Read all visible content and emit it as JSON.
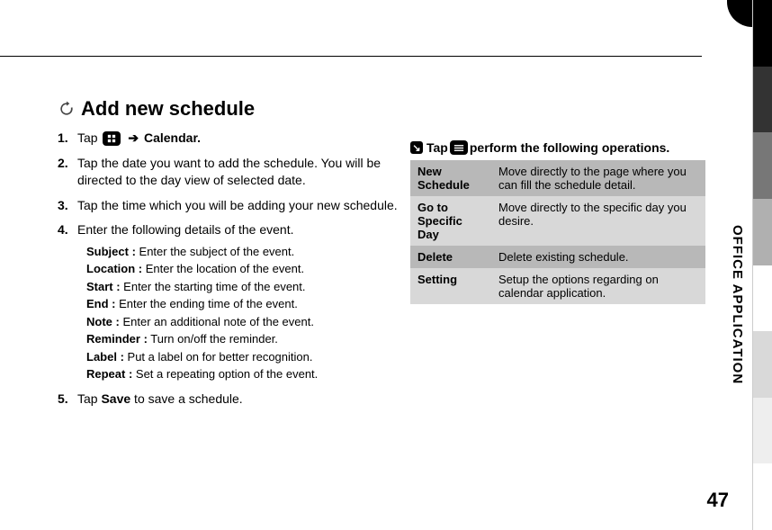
{
  "side_label": "OFFICE APPLICATION",
  "page_number": "47",
  "heading": "Add new schedule",
  "steps": {
    "s1": {
      "num": "1.",
      "prefix": "Tap ",
      "after_icon": " Calendar."
    },
    "s2": {
      "num": "2.",
      "text": "Tap the date you want to add the schedule. You will be directed to the day view of selected date."
    },
    "s3": {
      "num": "3.",
      "text": "Tap the time which you will be adding your new schedule."
    },
    "s4": {
      "num": "4.",
      "text": "Enter the following details of the event."
    },
    "s5": {
      "num": "5.",
      "prefix": "Tap ",
      "bold": "Save",
      "suffix": " to save a schedule."
    }
  },
  "details": [
    {
      "label": "Subject :",
      "text": " Enter the subject of the event."
    },
    {
      "label": "Location :",
      "text": " Enter the location of the event."
    },
    {
      "label": "Start :",
      "text": " Enter the starting time of the event."
    },
    {
      "label": "End :",
      "text": " Enter the ending time of the event."
    },
    {
      "label": "Note :",
      "text": " Enter an additional note of the event."
    },
    {
      "label": "Reminder :",
      "text": " Turn on/off the reminder."
    },
    {
      "label": "Label :",
      "text": " Put a label on for better recognition."
    },
    {
      "label": "Repeat :",
      "text": " Set a repeating option of the event."
    }
  ],
  "tip": {
    "prefix": " Tap ",
    "suffix": " perform the following operations."
  },
  "table": [
    {
      "label": "New Schedule",
      "desc": "Move directly to the page where you can fill the schedule detail."
    },
    {
      "label": "Go to Specific Day",
      "desc": "Move directly to the specific day you desire."
    },
    {
      "label": "Delete",
      "desc": "Delete existing schedule."
    },
    {
      "label": "Setting",
      "desc": "Setup the options regarding on calendar application."
    }
  ]
}
